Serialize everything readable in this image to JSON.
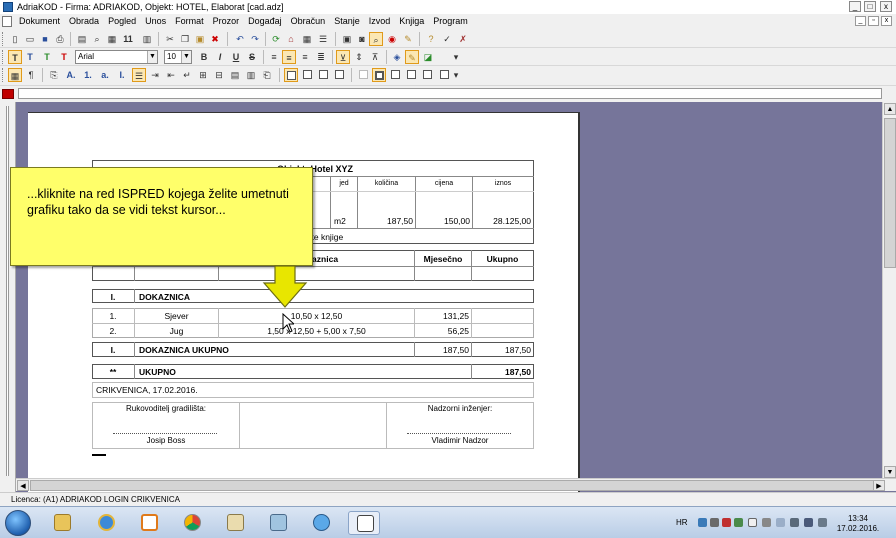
{
  "window": {
    "title": "AdriaKOD - Firma: ADRIAKOD,  Objekt: HOTEL, Elaborat [cad.adz]",
    "controls": [
      "_",
      "□",
      "x"
    ]
  },
  "menu": {
    "items": [
      "Dokument",
      "Obrada",
      "Pogled",
      "Unos",
      "Format",
      "Prozor",
      "Događaj",
      "Obračun",
      "Stanje",
      "Izvod",
      "Knjiga",
      "Program"
    ]
  },
  "format_toolbar": {
    "font": "Arial",
    "size": "10"
  },
  "document": {
    "header": {
      "title": "Objekt: Hotel XYZ",
      "col_jed": "jed",
      "col_kolicina": "količina",
      "col_cijena": "cijena",
      "col_iznos": "iznos",
      "row_jed": "m2",
      "row_kolicina": "187,50",
      "row_cijena": "150,00",
      "row_iznos": "28.125,00",
      "row_note": "jedinice nanske knjige"
    },
    "table_header": {
      "col_dokaznica": "Dokaznica",
      "col_mjesecno": "Mjesečno",
      "col_ukupno": "Ukupno"
    },
    "section": {
      "num": "I.",
      "label": "DOKAZNICA"
    },
    "rows": [
      {
        "num": "1.",
        "name": "Sjever",
        "formula": "10,50 x 12,50",
        "mjesecno": "131,25"
      },
      {
        "num": "2.",
        "name": "Jug",
        "formula": "1,50 x 12,50 + 5,00 x 7,50",
        "mjesecno": "56,25"
      }
    ],
    "subtotal": {
      "num": "I.",
      "label": "DOKAZNICA UKUPNO",
      "mjesecno": "187,50",
      "ukupno": "187,50"
    },
    "total": {
      "num": "**",
      "label": "UKUPNO",
      "ukupno": "187,50"
    },
    "place_date": "CRIKVENICA, 17.02.2016.",
    "signature_left": {
      "role": "Rukovoditelj gradilišta:",
      "name": "Josip Boss"
    },
    "signature_right": {
      "role": "Nadzorni inženjer:",
      "name": "Vladimir Nadzor"
    }
  },
  "callout": {
    "text": "...kliknite na red ISPRED kojega želite umetnuti grafiku tako da se vidi tekst kursor..."
  },
  "status": {
    "license": "Licenca: (A1) ADRIAKOD LOGIN CRIKVENICA"
  },
  "taskbar": {
    "lang": "HR",
    "time": "13:34",
    "date": "17.02.2016."
  },
  "colors": {
    "workspace": "#76759a",
    "callout": "#ffff6a",
    "callout_arrow": "#e8e600"
  }
}
